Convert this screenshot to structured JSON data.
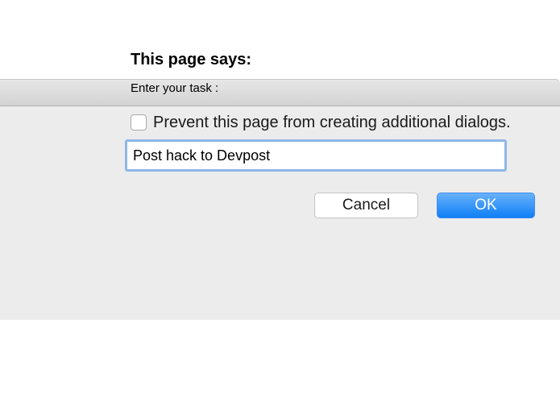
{
  "dialog": {
    "title": "This page says:",
    "message": "Enter your task :",
    "checkbox_label": "Prevent this page from creating additional dialogs.",
    "input_value": "Post hack to Devpost",
    "cancel_label": "Cancel",
    "ok_label": "OK"
  },
  "colors": {
    "ok_button": "#1a8cff",
    "input_focus_ring": "#8db7e8",
    "dialog_background": "#ececec"
  }
}
